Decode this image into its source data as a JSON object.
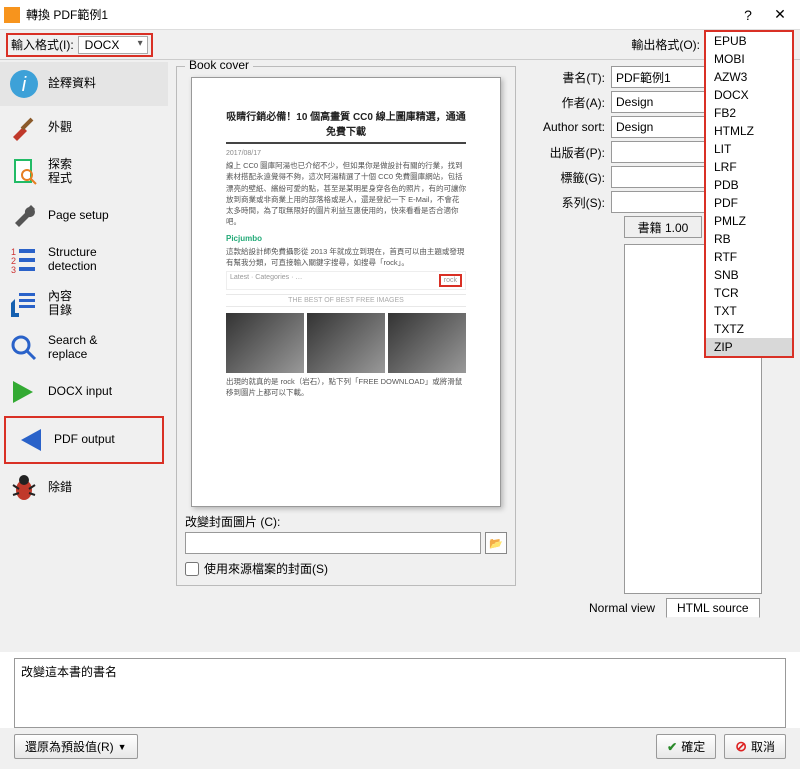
{
  "window": {
    "title": "轉換 PDF範例1"
  },
  "topbar": {
    "input_label": "輸入格式(I):",
    "input_value": "DOCX",
    "output_label": "輸出格式(O):"
  },
  "sidebar": {
    "items": [
      {
        "name": "interpret",
        "label": "詮釋資料"
      },
      {
        "name": "look",
        "label": "外觀"
      },
      {
        "name": "search",
        "label": "探索\n程式"
      },
      {
        "name": "page-setup",
        "label": "Page setup"
      },
      {
        "name": "structure",
        "label": "Structure\ndetection"
      },
      {
        "name": "content-toc",
        "label": "內容\n目錄"
      },
      {
        "name": "search-replace",
        "label": "Search &\nreplace"
      },
      {
        "name": "docx-input",
        "label": "DOCX input"
      },
      {
        "name": "pdf-output",
        "label": "PDF output"
      },
      {
        "name": "debug",
        "label": "除錯"
      }
    ]
  },
  "cover": {
    "legend": "Book cover",
    "preview_title": "吸睛行銷必備！10 個高畫質 CC0 線上圖庫精選，通通免費下載",
    "preview_date": "2017/08/17",
    "preview_p1": "線上 CC0 圖庫阿湯也已介紹不少，但如果你是做設計有關的行業，找到素材搭配永遠覺得不夠，這次阿湯精選了十個 CC0 免費圖庫網站，包括漂亮的壁紙、繽紛可愛的點，甚至是某明星身穿各色的照片，有的可讓你放到商業或非商業上用的部落格或是人，還是登記一下 E-Mail，不會花太多時間，為了取無限好的圖片利益互惠使用的，快來看看是否合適你吧。",
    "preview_brand": "Picjumbo",
    "preview_p2": "這款給設計師免費攝影從 2013 年就成立到現在，首頁可以由主題或發現有幫我分類，可直接輸入關鍵字搜尋，如搜尋「rock」。",
    "nav_items": "Latest · Categories · …",
    "search_term": "rock",
    "title2": "THE BEST OF BEST FREE IMAGES",
    "footer_text": "出現的就真的是 rock（岩石），點下列「FREE DOWNLOAD」或將滑鼠移到圖片上都可以下載。",
    "path_label": "改變封面圖片 (C):",
    "path_value": "",
    "use_source_label": "使用來源檔案的封面(S)"
  },
  "meta": {
    "book_label": "書名(T):",
    "book_value": "PDF範例1",
    "author_label": "作者(A):",
    "author_value": "Design",
    "authorsort_label": "Author sort:",
    "authorsort_value": "Design",
    "publisher_label": "出版者(P):",
    "publisher_value": "",
    "tags_label": "標籤(G):",
    "tags_value": "",
    "series_label": "系列(S):",
    "series_value": "",
    "series_index": "書籍 1.00",
    "tab_normal": "Normal view",
    "tab_html": "HTML source"
  },
  "output_formats": [
    "EPUB",
    "MOBI",
    "AZW3",
    "DOCX",
    "FB2",
    "HTMLZ",
    "LIT",
    "LRF",
    "PDB",
    "PDF",
    "PMLZ",
    "RB",
    "RTF",
    "SNB",
    "TCR",
    "TXT",
    "TXTZ",
    "ZIP"
  ],
  "output_selected": "ZIP",
  "titlechange": {
    "text": "改變這本書的書名"
  },
  "bottom": {
    "restore": "還原為預設值(R)",
    "ok": "確定",
    "cancel": "取消"
  }
}
